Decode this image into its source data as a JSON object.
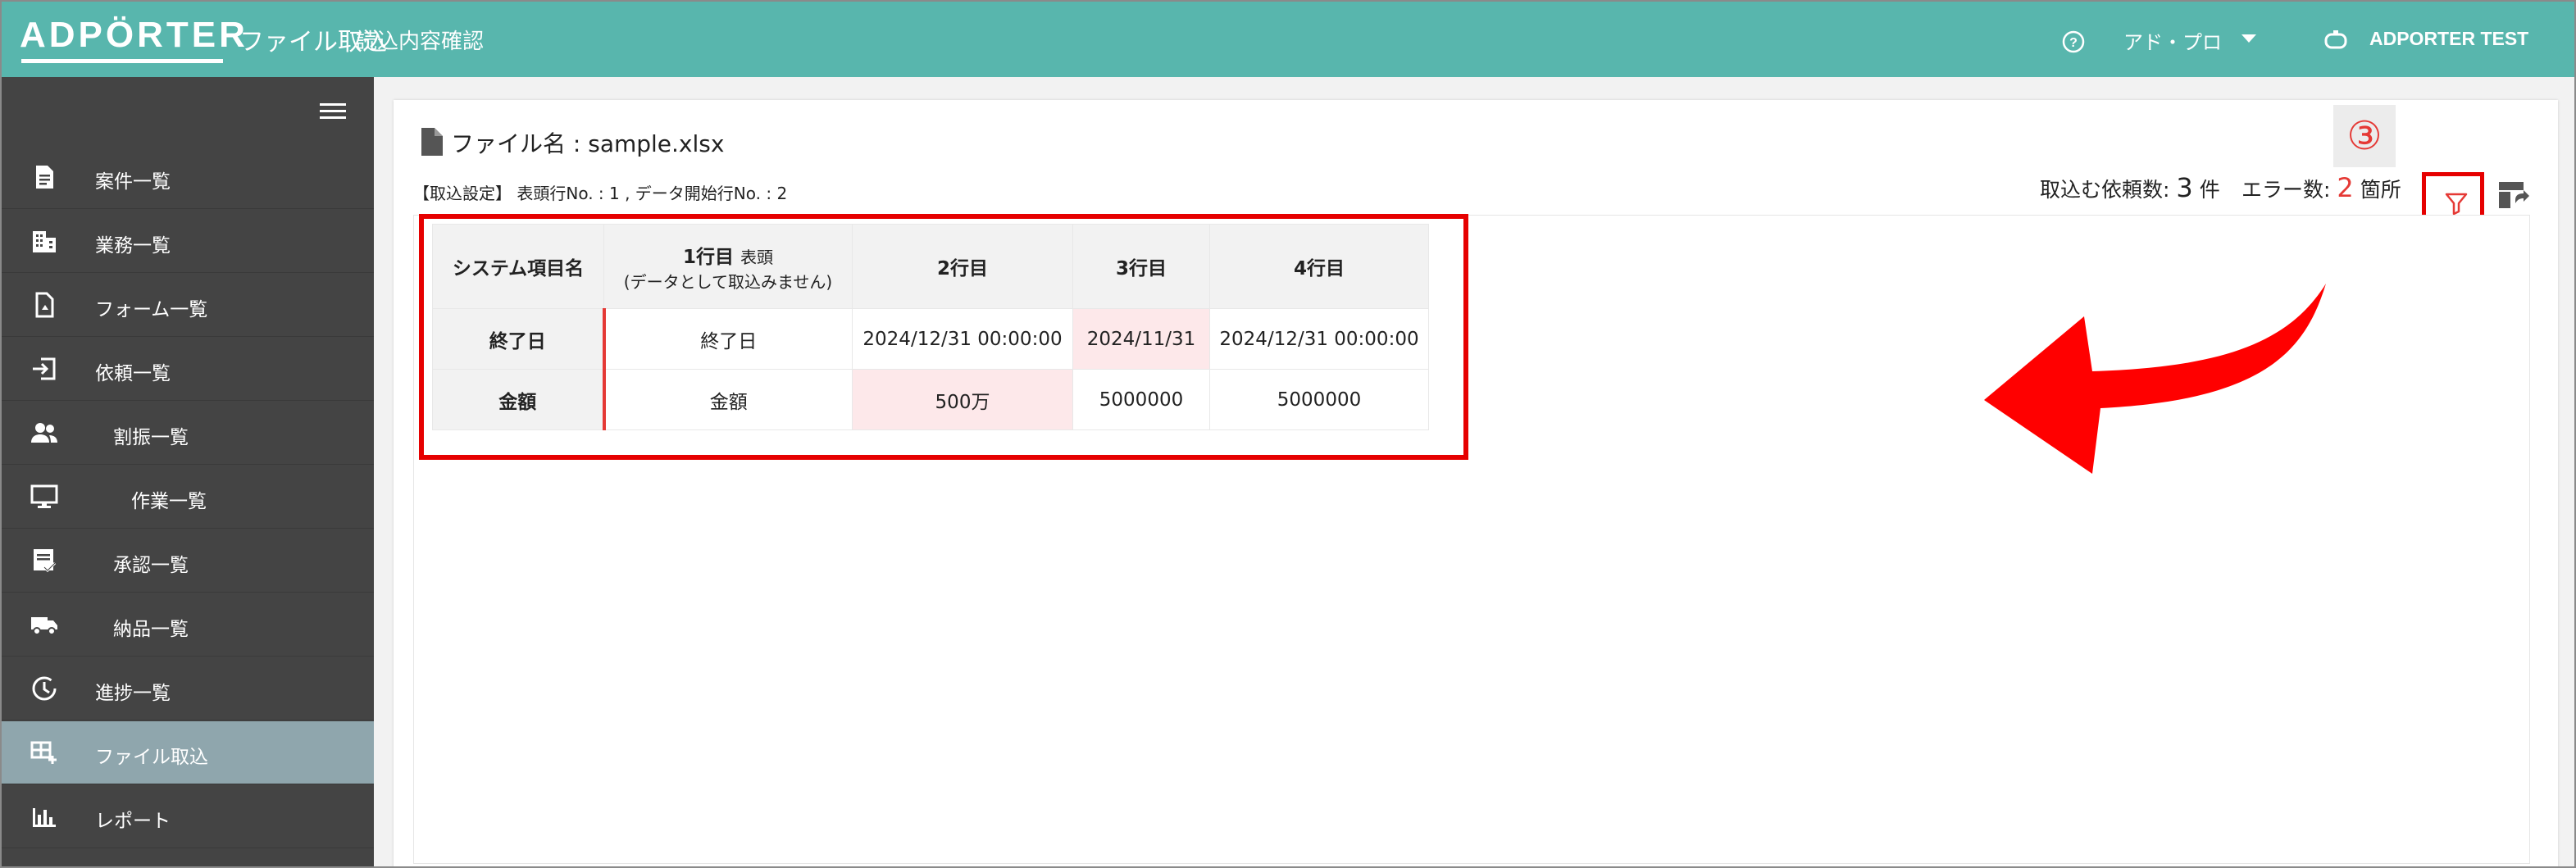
{
  "header": {
    "logo_text": "ADPÖRTER",
    "title": "ファイル取込",
    "subtitle": "読込内容確認",
    "user_org": "アド・プロ",
    "account_name": "ADPORTER TEST"
  },
  "sidebar": {
    "items": [
      {
        "label": "案件一覧",
        "icon": "document-list-icon"
      },
      {
        "label": "業務一覧",
        "icon": "building-icon"
      },
      {
        "label": "フォーム一覧",
        "icon": "form-file-icon"
      },
      {
        "label": "依頼一覧",
        "icon": "login-icon"
      },
      {
        "label": "割振一覧",
        "icon": "people-icon"
      },
      {
        "label": "作業一覧",
        "icon": "monitor-icon"
      },
      {
        "label": "承認一覧",
        "icon": "approval-icon"
      },
      {
        "label": "納品一覧",
        "icon": "truck-icon"
      },
      {
        "label": "進捗一覧",
        "icon": "clock-icon"
      },
      {
        "label": "ファイル取込",
        "icon": "table-add-icon"
      },
      {
        "label": "レポート",
        "icon": "bar-chart-icon"
      }
    ]
  },
  "main": {
    "file_label": "ファイル名 : sample.xlsx",
    "import_settings": "【取込設定】 表頭行No. : 1 , データ開始行No. : 2",
    "request_count_label": "取込む依頼数:",
    "request_count": "3",
    "request_count_unit": "件",
    "error_count_label": "エラー数:",
    "error_count": "2",
    "error_count_unit": "箇所",
    "step_badge": "③",
    "table": {
      "headers": {
        "col0": "システム項目名",
        "col1": "1行目",
        "col1_tag": "表頭",
        "col1_note": "(データとして取込みません)",
        "col2": "2行目",
        "col3": "3行目",
        "col4": "4行目"
      },
      "rows": [
        {
          "name": "終了日",
          "c1": "終了日",
          "c2": "2024/12/31 00:00:00",
          "c3": "2024/11/31",
          "c4": "2024/12/31 00:00:00"
        },
        {
          "name": "金額",
          "c1": "金額",
          "c2": "500万",
          "c3": "5000000",
          "c4": "5000000"
        }
      ]
    }
  },
  "colors": {
    "header": "#58b6ad",
    "sidebar": "#444444",
    "sidebar_active": "#8fa6ad",
    "error_cell": "#fde8ea",
    "error_text": "#e53935",
    "annotation": "#e60000"
  }
}
